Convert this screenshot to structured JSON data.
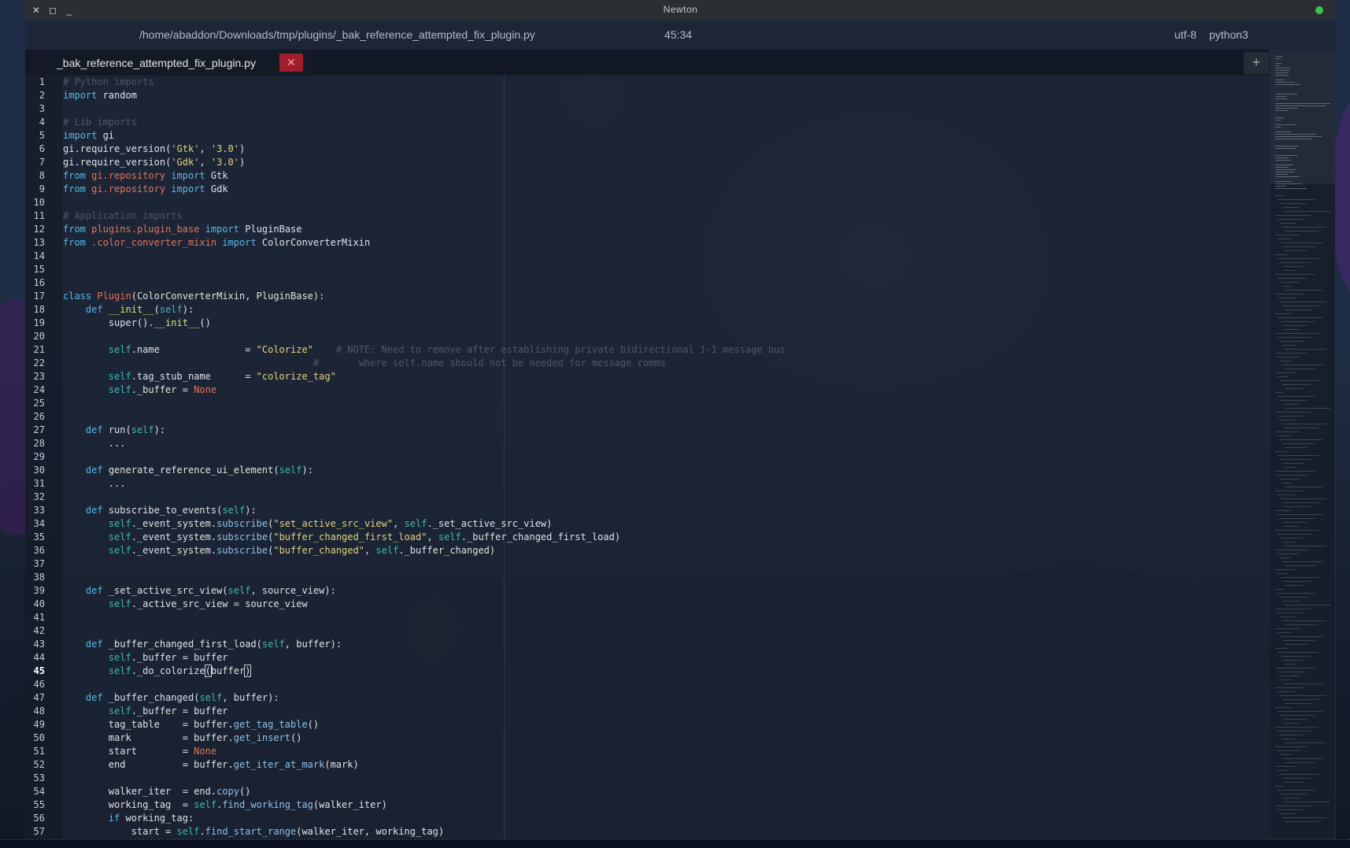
{
  "window": {
    "title": "Newton",
    "close_glyph": "✕",
    "maximize_glyph": "◻",
    "minimize_glyph": "_"
  },
  "header": {
    "file_path": "/home/abaddon/Downloads/tmp/plugins/_bak_reference_attempted_fix_plugin.py",
    "cursor_position": "45:34",
    "encoding": "utf-8",
    "language": "python3"
  },
  "tabs": [
    {
      "label": "_bak_reference_attempted_fix_plugin.py",
      "close_glyph": "✕"
    }
  ],
  "add_tab_glyph": "+",
  "editor": {
    "current_line": 45,
    "lines": [
      {
        "n": "1",
        "t": [
          [
            "# Python imports",
            "cm"
          ]
        ]
      },
      {
        "n": "2",
        "t": [
          [
            "import",
            "kw"
          ],
          [
            " random",
            ""
          ]
        ]
      },
      {
        "n": "3",
        "t": []
      },
      {
        "n": "4",
        "t": [
          [
            "# Lib imports",
            "cm"
          ]
        ]
      },
      {
        "n": "5",
        "t": [
          [
            "import",
            "kw"
          ],
          [
            " gi",
            ""
          ]
        ]
      },
      {
        "n": "6",
        "t": [
          [
            "gi.",
            ""
          ],
          [
            "require_version",
            ""
          ],
          [
            "(",
            ""
          ],
          [
            "'Gtk'",
            "st"
          ],
          [
            ", ",
            ""
          ],
          [
            "'3.0'",
            "st"
          ],
          [
            ")",
            ""
          ]
        ]
      },
      {
        "n": "7",
        "t": [
          [
            "gi.",
            ""
          ],
          [
            "require_version",
            ""
          ],
          [
            "(",
            ""
          ],
          [
            "'Gdk'",
            "st"
          ],
          [
            ", ",
            ""
          ],
          [
            "'3.0'",
            "st"
          ],
          [
            ")",
            ""
          ]
        ]
      },
      {
        "n": "8",
        "t": [
          [
            "from",
            "kw"
          ],
          [
            " ",
            ""
          ],
          [
            "gi.repository",
            "md"
          ],
          [
            " ",
            ""
          ],
          [
            "import",
            "kw"
          ],
          [
            " Gtk",
            ""
          ]
        ]
      },
      {
        "n": "9",
        "t": [
          [
            "from",
            "kw"
          ],
          [
            " ",
            ""
          ],
          [
            "gi.repository",
            "md"
          ],
          [
            " ",
            ""
          ],
          [
            "import",
            "kw"
          ],
          [
            " Gdk",
            ""
          ]
        ]
      },
      {
        "n": "10",
        "t": []
      },
      {
        "n": "11",
        "t": [
          [
            "# Application imports",
            "cm"
          ]
        ]
      },
      {
        "n": "12",
        "t": [
          [
            "from",
            "kw"
          ],
          [
            " ",
            ""
          ],
          [
            "plugins.plugin_base",
            "md"
          ],
          [
            " ",
            ""
          ],
          [
            "import",
            "kw"
          ],
          [
            " PluginBase",
            ""
          ]
        ]
      },
      {
        "n": "13",
        "t": [
          [
            "from",
            "kw"
          ],
          [
            " ",
            ""
          ],
          [
            ".color_converter_mixin",
            "md"
          ],
          [
            " ",
            ""
          ],
          [
            "import",
            "kw"
          ],
          [
            " ColorConverterMixin",
            ""
          ]
        ]
      },
      {
        "n": "14",
        "t": []
      },
      {
        "n": "15",
        "t": []
      },
      {
        "n": "16",
        "t": []
      },
      {
        "n": "17",
        "t": [
          [
            "class",
            "kw"
          ],
          [
            " ",
            ""
          ],
          [
            "Plugin",
            "cl"
          ],
          [
            "(ColorConverterMixin, PluginBase):",
            ""
          ]
        ]
      },
      {
        "n": "18",
        "t": [
          [
            "    ",
            ""
          ],
          [
            "def",
            "kw"
          ],
          [
            " ",
            ""
          ],
          [
            "__init__",
            "fn"
          ],
          [
            "(",
            ""
          ],
          [
            "self",
            "sf"
          ],
          [
            "):",
            ""
          ]
        ]
      },
      {
        "n": "19",
        "t": [
          [
            "        super().",
            ""
          ],
          [
            "__init__",
            "fn"
          ],
          [
            "()",
            ""
          ]
        ]
      },
      {
        "n": "20",
        "t": []
      },
      {
        "n": "21",
        "t": [
          [
            "        ",
            ""
          ],
          [
            "self",
            "sf"
          ],
          [
            ".name               = ",
            ""
          ],
          [
            "\"Colorize\"",
            "st"
          ],
          [
            "    ",
            ""
          ],
          [
            "# NOTE: Need to remove after establishing private bidirectional 1-1 message bus",
            "cm"
          ]
        ]
      },
      {
        "n": "22",
        "t": [
          [
            "                                            ",
            ""
          ],
          [
            "#       where self.name should not be needed for message comms",
            "cm"
          ]
        ]
      },
      {
        "n": "23",
        "t": [
          [
            "        ",
            ""
          ],
          [
            "self",
            "sf"
          ],
          [
            ".tag_stub_name      = ",
            ""
          ],
          [
            "\"colorize_tag\"",
            "st"
          ]
        ]
      },
      {
        "n": "24",
        "t": [
          [
            "        ",
            ""
          ],
          [
            "self",
            "sf"
          ],
          [
            "._buffer = ",
            ""
          ],
          [
            "None",
            "nn"
          ]
        ]
      },
      {
        "n": "25",
        "t": []
      },
      {
        "n": "26",
        "t": []
      },
      {
        "n": "27",
        "t": [
          [
            "    ",
            ""
          ],
          [
            "def",
            "kw"
          ],
          [
            " run(",
            ""
          ],
          [
            "self",
            "sf"
          ],
          [
            "):",
            ""
          ]
        ]
      },
      {
        "n": "28",
        "t": [
          [
            "        ...",
            ""
          ]
        ]
      },
      {
        "n": "29",
        "t": []
      },
      {
        "n": "30",
        "t": [
          [
            "    ",
            ""
          ],
          [
            "def",
            "kw"
          ],
          [
            " generate_reference_ui_element(",
            ""
          ],
          [
            "self",
            "sf"
          ],
          [
            "):",
            ""
          ]
        ]
      },
      {
        "n": "31",
        "t": [
          [
            "        ...",
            ""
          ]
        ]
      },
      {
        "n": "32",
        "t": []
      },
      {
        "n": "33",
        "t": [
          [
            "    ",
            ""
          ],
          [
            "def",
            "kw"
          ],
          [
            " subscribe_to_events(",
            ""
          ],
          [
            "self",
            "sf"
          ],
          [
            "):",
            ""
          ]
        ]
      },
      {
        "n": "34",
        "t": [
          [
            "        ",
            ""
          ],
          [
            "self",
            "sf"
          ],
          [
            "._event_system.",
            ""
          ],
          [
            "subscribe",
            "at"
          ],
          [
            "(",
            ""
          ],
          [
            "\"set_active_src_view\"",
            "st"
          ],
          [
            ", ",
            ""
          ],
          [
            "self",
            "sf"
          ],
          [
            "._set_active_src_view)",
            ""
          ]
        ]
      },
      {
        "n": "35",
        "t": [
          [
            "        ",
            ""
          ],
          [
            "self",
            "sf"
          ],
          [
            "._event_system.",
            ""
          ],
          [
            "subscribe",
            "at"
          ],
          [
            "(",
            ""
          ],
          [
            "\"buffer_changed_first_load\"",
            "st"
          ],
          [
            ", ",
            ""
          ],
          [
            "self",
            "sf"
          ],
          [
            "._buffer_changed_first_load)",
            ""
          ]
        ]
      },
      {
        "n": "36",
        "t": [
          [
            "        ",
            ""
          ],
          [
            "self",
            "sf"
          ],
          [
            "._event_system.",
            ""
          ],
          [
            "subscribe",
            "at"
          ],
          [
            "(",
            ""
          ],
          [
            "\"buffer_changed\"",
            "st"
          ],
          [
            ", ",
            ""
          ],
          [
            "self",
            "sf"
          ],
          [
            "._buffer_changed)",
            ""
          ]
        ]
      },
      {
        "n": "37",
        "t": []
      },
      {
        "n": "38",
        "t": []
      },
      {
        "n": "39",
        "t": [
          [
            "    ",
            ""
          ],
          [
            "def",
            "kw"
          ],
          [
            " _set_active_src_view(",
            ""
          ],
          [
            "self",
            "sf"
          ],
          [
            ", source_view):",
            ""
          ]
        ]
      },
      {
        "n": "40",
        "t": [
          [
            "        ",
            ""
          ],
          [
            "self",
            "sf"
          ],
          [
            "._active_src_view = source_view",
            ""
          ]
        ]
      },
      {
        "n": "41",
        "t": []
      },
      {
        "n": "42",
        "t": []
      },
      {
        "n": "43",
        "t": [
          [
            "    ",
            ""
          ],
          [
            "def",
            "kw"
          ],
          [
            " _buffer_changed_first_load(",
            ""
          ],
          [
            "self",
            "sf"
          ],
          [
            ", buffer):",
            ""
          ]
        ]
      },
      {
        "n": "44",
        "t": [
          [
            "        ",
            ""
          ],
          [
            "self",
            "sf"
          ],
          [
            "._buffer = buffer",
            ""
          ]
        ]
      },
      {
        "n": "45",
        "t": [
          [
            "        ",
            ""
          ],
          [
            "self",
            "sf"
          ],
          [
            "._do_colorize",
            ""
          ],
          [
            "(",
            "bm"
          ],
          [
            "buffer",
            ""
          ],
          [
            ")",
            "bm"
          ]
        ]
      },
      {
        "n": "46",
        "t": []
      },
      {
        "n": "47",
        "t": [
          [
            "    ",
            ""
          ],
          [
            "def",
            "kw"
          ],
          [
            " _buffer_changed(",
            ""
          ],
          [
            "self",
            "sf"
          ],
          [
            ", buffer):",
            ""
          ]
        ]
      },
      {
        "n": "48",
        "t": [
          [
            "        ",
            ""
          ],
          [
            "self",
            "sf"
          ],
          [
            "._buffer = buffer",
            ""
          ]
        ]
      },
      {
        "n": "49",
        "t": [
          [
            "        tag_table    = buffer.",
            ""
          ],
          [
            "get_tag_table",
            "at"
          ],
          [
            "()",
            ""
          ]
        ]
      },
      {
        "n": "50",
        "t": [
          [
            "        mark         = buffer.",
            ""
          ],
          [
            "get_insert",
            "at"
          ],
          [
            "()",
            ""
          ]
        ]
      },
      {
        "n": "51",
        "t": [
          [
            "        start        = ",
            ""
          ],
          [
            "None",
            "nn"
          ]
        ]
      },
      {
        "n": "52",
        "t": [
          [
            "        end          = buffer.",
            ""
          ],
          [
            "get_iter_at_mark",
            "at"
          ],
          [
            "(mark)",
            ""
          ]
        ]
      },
      {
        "n": "53",
        "t": []
      },
      {
        "n": "54",
        "t": [
          [
            "        walker_iter  = end.",
            ""
          ],
          [
            "copy",
            "at"
          ],
          [
            "()",
            ""
          ]
        ]
      },
      {
        "n": "55",
        "t": [
          [
            "        working_tag  = ",
            ""
          ],
          [
            "self",
            "sf"
          ],
          [
            ".",
            ""
          ],
          [
            "find_working_tag",
            "at"
          ],
          [
            "(walker_iter)",
            ""
          ]
        ]
      },
      {
        "n": "56",
        "t": [
          [
            "        ",
            ""
          ],
          [
            "if",
            "kw"
          ],
          [
            " working_tag:",
            ""
          ]
        ]
      },
      {
        "n": "57",
        "t": [
          [
            "            start = ",
            ""
          ],
          [
            "self",
            "sf"
          ],
          [
            ".",
            ""
          ],
          [
            "find_start_range",
            "at"
          ],
          [
            "(walker_iter, working_tag)",
            ""
          ]
        ]
      }
    ]
  },
  "icons": {
    "close": "close-icon",
    "maximize": "maximize-icon",
    "minimize": "minimize-icon",
    "status": "status-dot-icon",
    "tab_close": "tab-close-icon",
    "add_tab": "plus-icon"
  },
  "colors": {
    "keyword": "#58b8e8",
    "string": "#e3d27a",
    "comment": "#4e5766",
    "module": "#e3745a",
    "status_dot": "#3ac24a",
    "tab_close_bg": "#a01e2c"
  }
}
